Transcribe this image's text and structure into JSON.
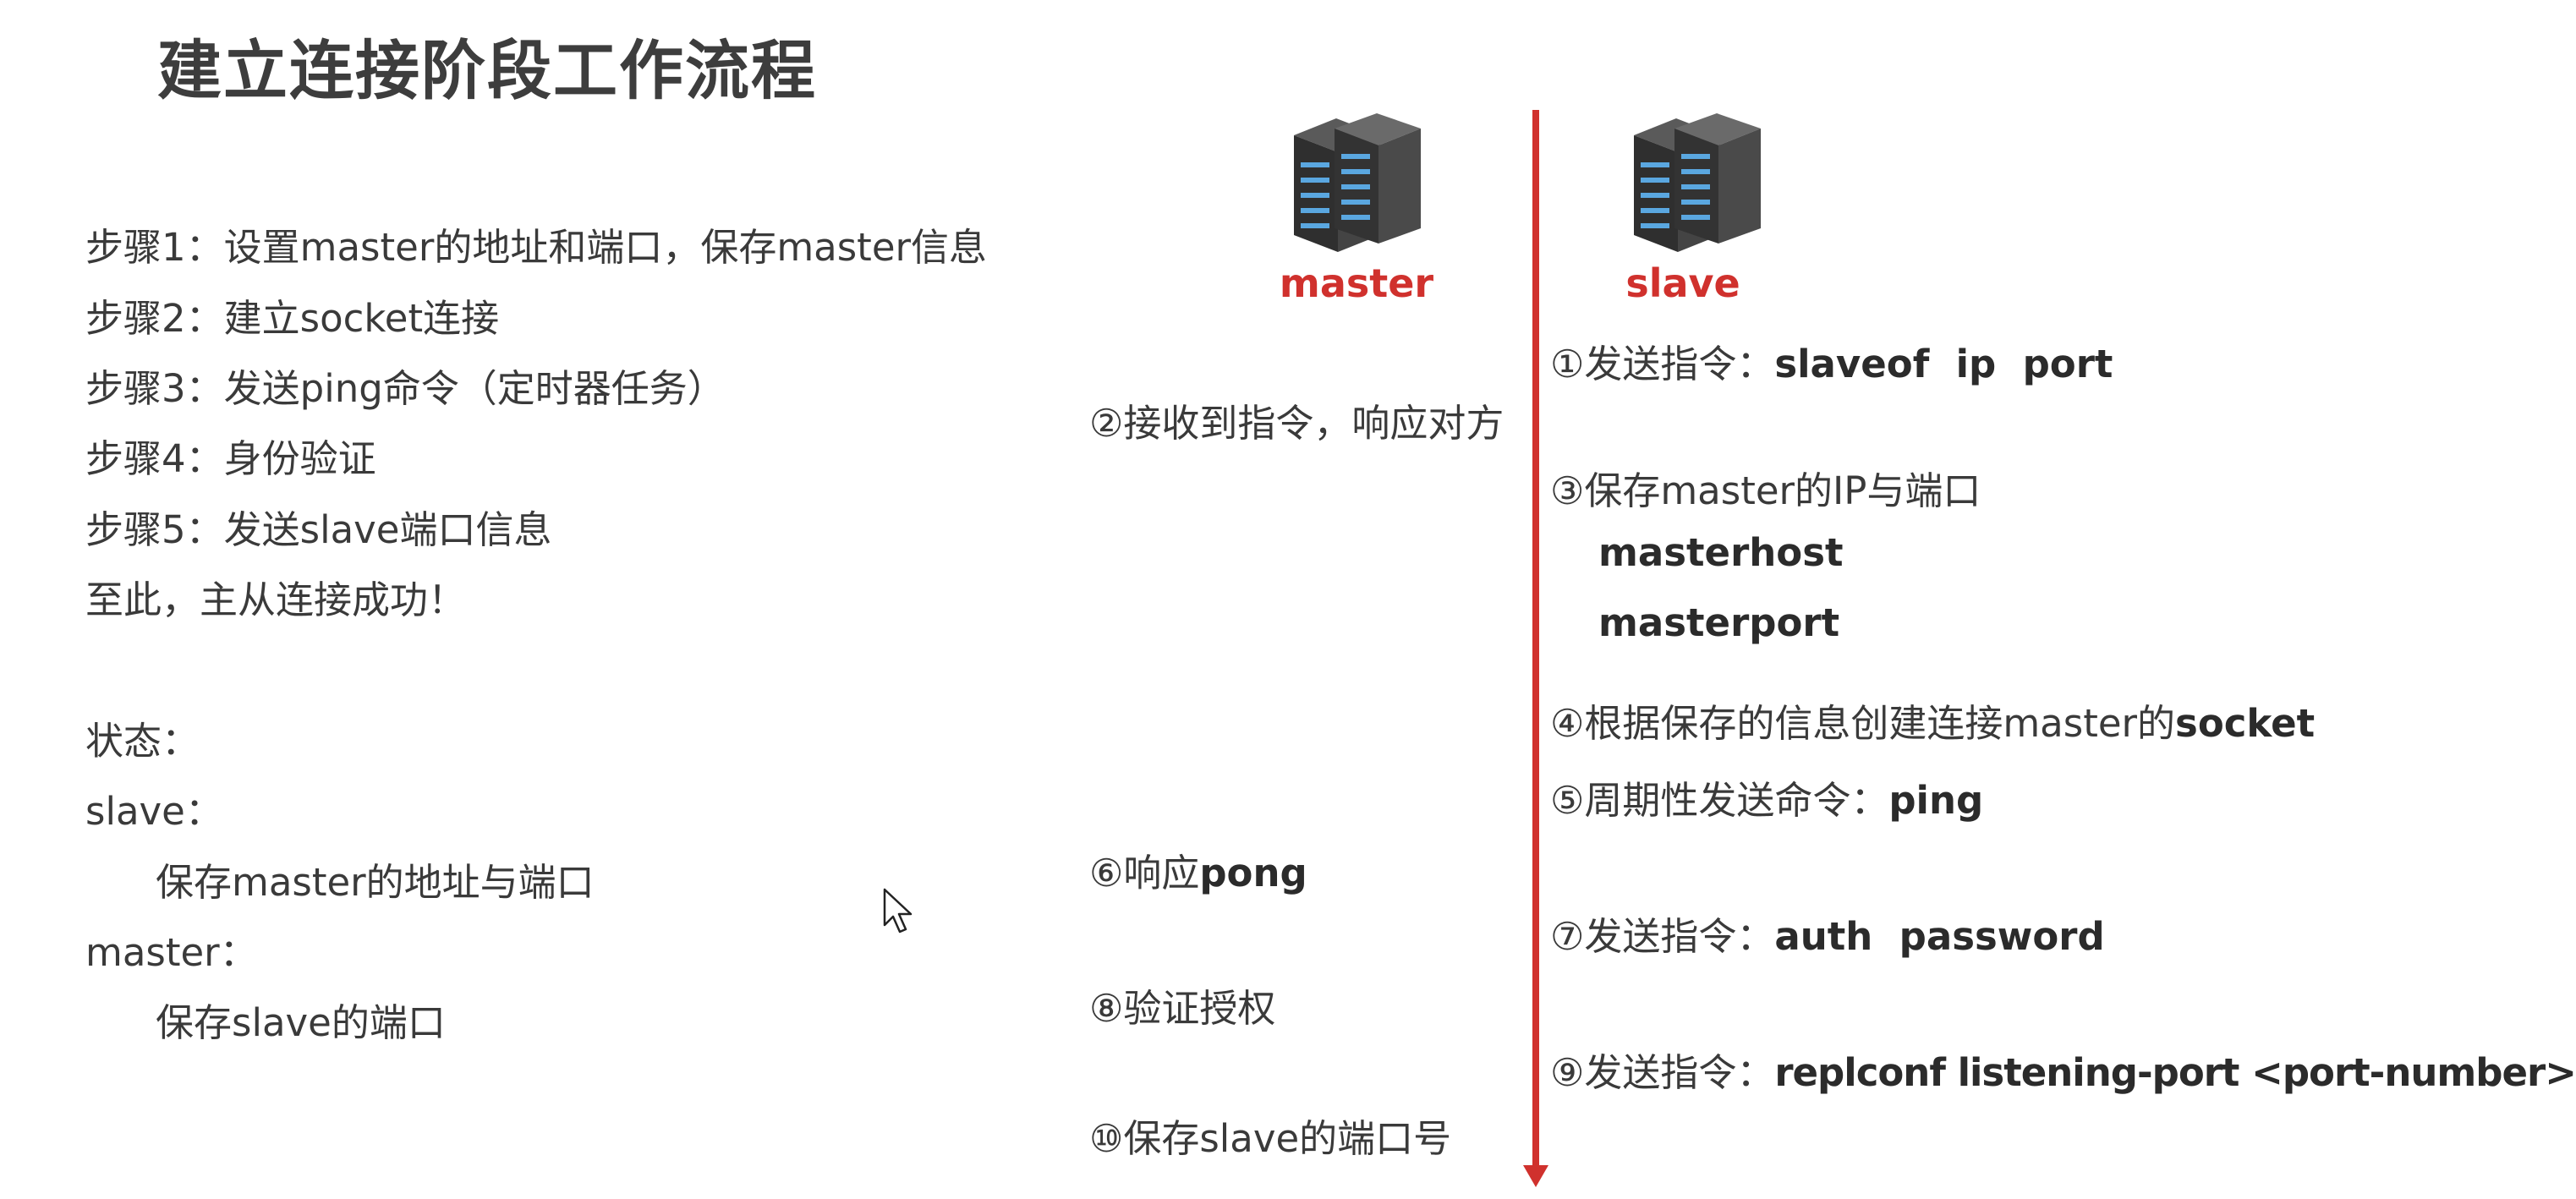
{
  "title": "建立连接阶段工作流程",
  "steps_list": [
    "步骤1：设置master的地址和端口，保存master信息",
    "步骤2：建立socket连接",
    "步骤3：发送ping命令（定时器任务）",
    "步骤4：身份验证",
    "步骤5：发送slave端口信息",
    "至此，主从连接成功！"
  ],
  "status": {
    "heading": "状态：",
    "slave_label": "slave：",
    "slave_detail": "保存master的地址与端口",
    "master_label": "master：",
    "master_detail": "保存slave的端口"
  },
  "roles": {
    "master": "master",
    "slave": "slave"
  },
  "flow": {
    "s1_prefix": "①发送指令：",
    "s1_bold": "slaveof  ip  port",
    "s2": "②接收到指令，响应对方",
    "s3": "③保存master的IP与端口",
    "s3_sub1": "masterhost",
    "s3_sub2": "masterport",
    "s4_prefix": "④根据保存的信息创建连接master的",
    "s4_bold": "socket",
    "s5_prefix": "⑤周期性发送命令：",
    "s5_bold": "ping",
    "s6_prefix": "⑥响应",
    "s6_bold": "pong",
    "s7_prefix": "⑦发送指令：",
    "s7_bold": "auth  password",
    "s8": "⑧验证授权",
    "s9_prefix": "⑨发送指令：",
    "s9_bold": "replconf listening-port <port-number>",
    "s10": "⑩保存slave的端口号"
  },
  "colors": {
    "accent": "#d0312d",
    "text": "#3a3a3a"
  },
  "icons": [
    "server-rack-icon",
    "server-rack-icon",
    "mouse-cursor-icon"
  ]
}
